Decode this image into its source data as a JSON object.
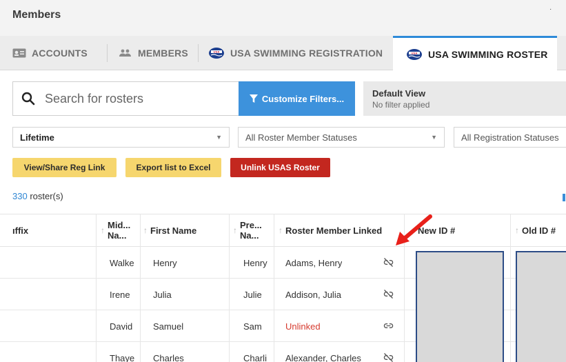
{
  "page": {
    "title": "Members"
  },
  "tabs": [
    {
      "label": "ACCOUNTS",
      "icon": "id-card-icon"
    },
    {
      "label": "MEMBERS",
      "icon": "people-icon"
    },
    {
      "label": "USA SWIMMING REGISTRATION",
      "icon": "usa-swimming-logo-icon"
    },
    {
      "label": "USA SWIMMING ROSTER",
      "icon": "usa-swimming-logo-icon",
      "active": true
    }
  ],
  "search": {
    "placeholder": "Search for rosters"
  },
  "filters": {
    "customize_label": "Customize Filters...",
    "view_title": "Default View",
    "view_subtitle": "No filter applied"
  },
  "selects": {
    "period": "Lifetime",
    "roster_status": "All Roster Member Statuses",
    "registration_status": "All Registration Statuses"
  },
  "actions": {
    "view_share": "View/Share Reg Link",
    "export": "Export list to Excel",
    "unlink": "Unlink USAS Roster"
  },
  "count": {
    "number": "330",
    "label": " roster(s)"
  },
  "table": {
    "headers": {
      "suffix": "ıffix",
      "middle_1": "Mid...",
      "middle_2": "Na...",
      "first": "First Name",
      "preferred_1": "Pre...",
      "preferred_2": "Na...",
      "linked": "Roster Member Linked",
      "new_id": "New ID #",
      "old_id": "Old ID #"
    },
    "rows": [
      {
        "middle": "Walke",
        "first": "Henry",
        "preferred": "Henry",
        "linked": "Adams, Henry",
        "status": "linked"
      },
      {
        "middle": "Irene",
        "first": "Julia",
        "preferred": "Julie",
        "linked": "Addison, Julia",
        "status": "linked"
      },
      {
        "middle": "David",
        "first": "Samuel",
        "preferred": "Sam",
        "linked": "Unlinked",
        "status": "unlinked"
      },
      {
        "middle": "Thaye",
        "first": "Charles",
        "preferred": "Charli",
        "linked": "Alexander, Charles",
        "status": "linked"
      }
    ]
  },
  "colors": {
    "accent_blue": "#3d92dc",
    "tab_active_border": "#2d8ad8",
    "yellow_button": "#f6d66e",
    "red_button": "#c3271f",
    "unlinked_text": "#d63a2e",
    "annotation_arrow": "#e8201a",
    "redaction_border": "#2c4c86"
  }
}
